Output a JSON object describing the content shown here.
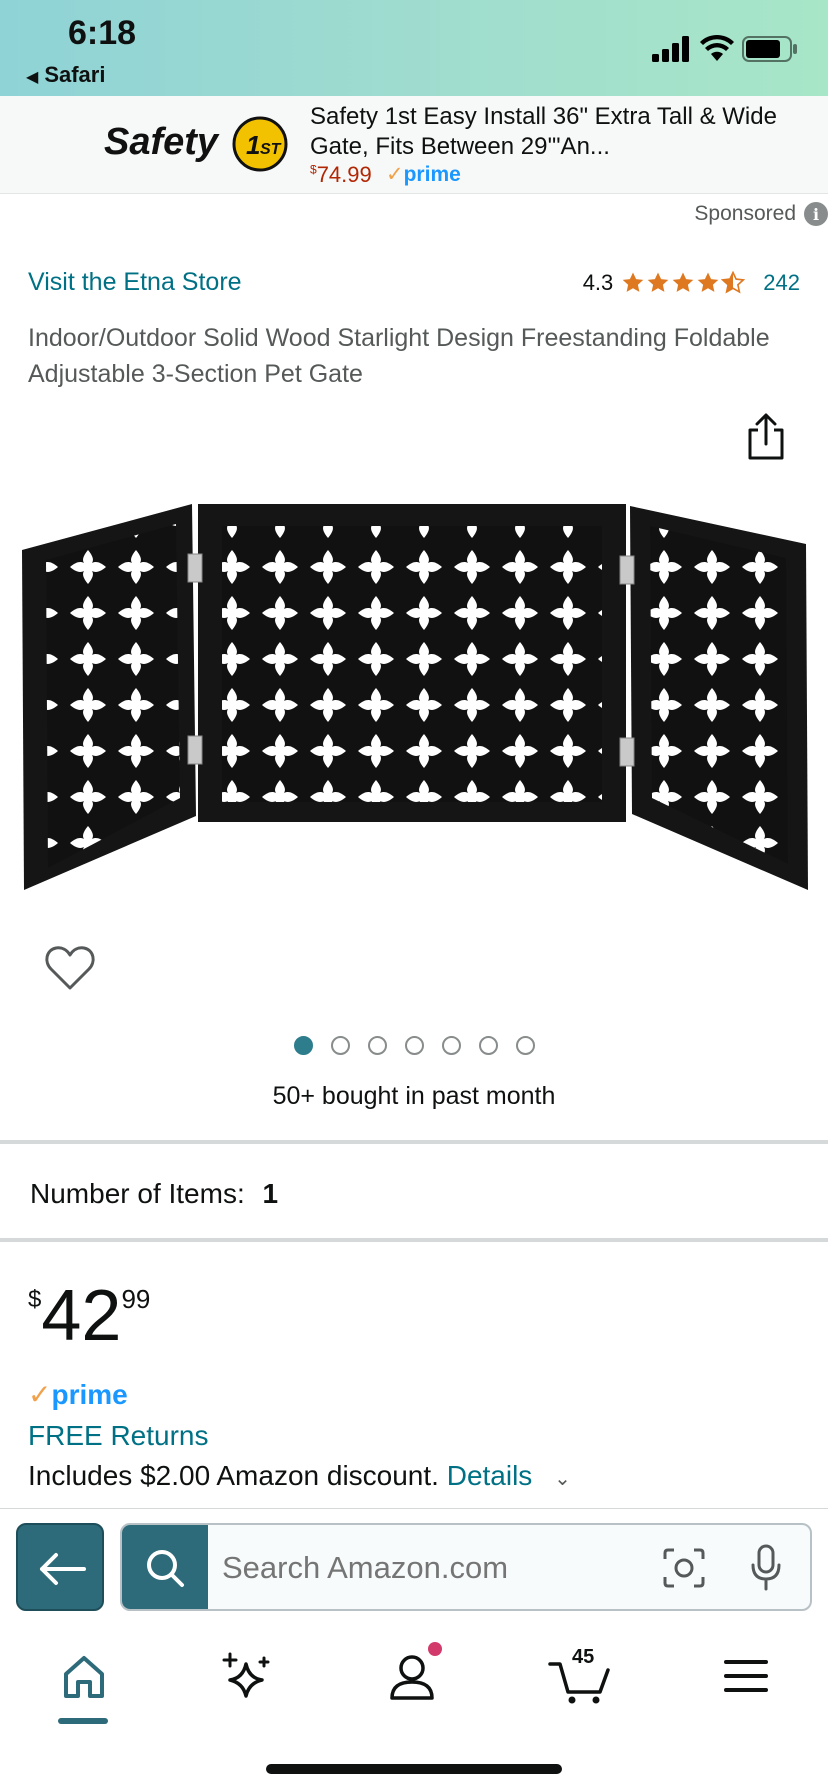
{
  "status_bar": {
    "time": "6:18",
    "back_app": "Safari"
  },
  "sponsored_ad": {
    "brand_logo_text": "Safety 1st",
    "title": "Safety 1st Easy Install 36\" Extra Tall & Wide Gate, Fits Between 29'\"An...",
    "price_symbol": "$",
    "price": "74.99",
    "prime": "prime"
  },
  "sponsored_label": "Sponsored",
  "store_link": "Visit the Etna Store",
  "rating": {
    "value": "4.3",
    "stars": 4.3,
    "count": "242"
  },
  "product_title": "Indoor/Outdoor Solid Wood Starlight Design Freestanding Foldable Adjustable 3-Section Pet Gate",
  "gallery": {
    "image_count": 7,
    "active_index": 0
  },
  "bought_text": "50+ bought in past month",
  "number_of_items": {
    "label": "Number of Items:",
    "value": "1"
  },
  "price": {
    "symbol": "$",
    "whole": "42",
    "fraction": "99"
  },
  "prime_label": "prime",
  "free_returns": "FREE Returns",
  "discount": {
    "text": "Includes $2.00 Amazon discount.",
    "details_link": "Details"
  },
  "search": {
    "placeholder": "Search Amazon.com"
  },
  "tabbar": {
    "cart_count": "45"
  },
  "colors": {
    "link": "#007185",
    "accent": "#2e6b7a",
    "price_red": "#b12704",
    "prime_blue": "#1a98ff",
    "star": "#e47911"
  }
}
